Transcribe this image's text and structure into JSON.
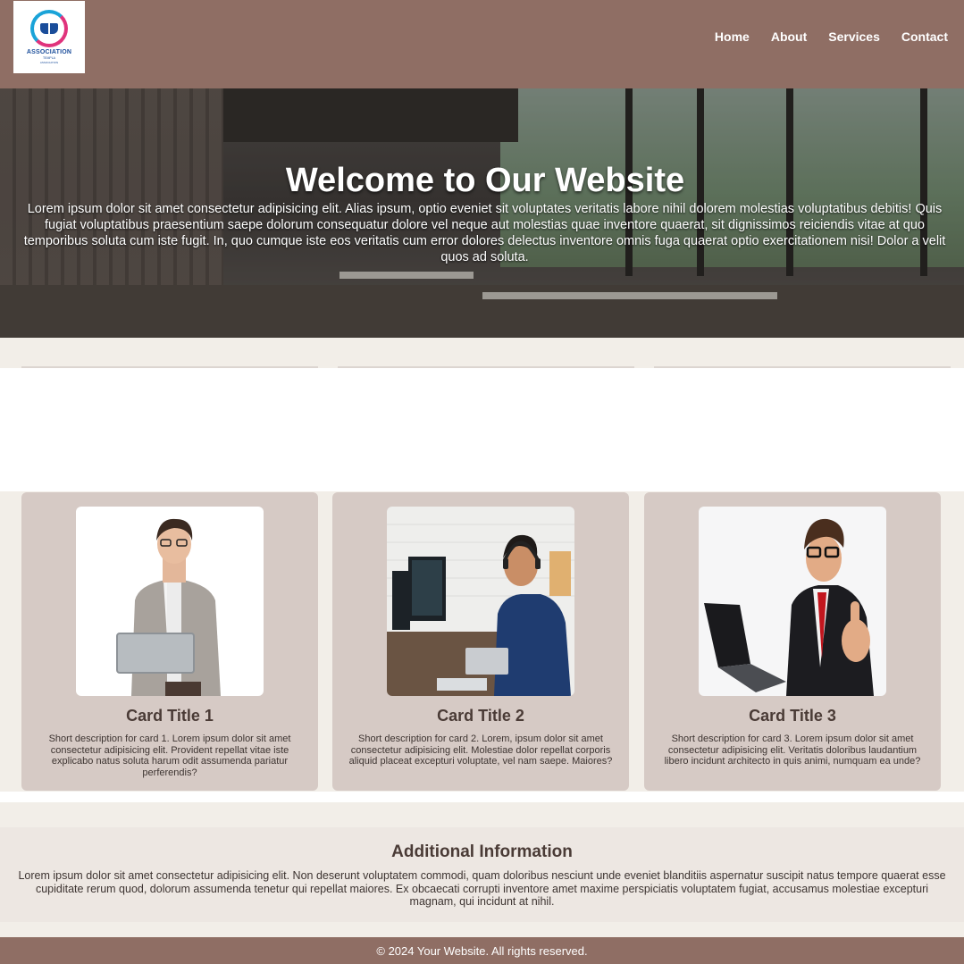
{
  "header": {
    "logo_text": "ASSOCIATION",
    "logo_sub": "TEMPLA",
    "logo_sub2": "ASSOCIATION",
    "nav": [
      "Home",
      "About",
      "Services",
      "Contact"
    ]
  },
  "hero": {
    "title": "Welcome to Our Website",
    "text": "Lorem ipsum dolor sit amet consectetur adipisicing elit. Alias ipsum, optio eveniet sit voluptates veritatis labore nihil dolorem molestias voluptatibus debitis! Quis fugiat voluptatibus praesentium saepe dolorum consequatur dolore vel neque aut molestias quae inventore quaerat, sit dignissimos reiciendis vitae at quo temporibus soluta cum iste fugit. In, quo cumque iste eos veritatis cum error dolores delectus inventore omnis fuga quaerat optio exercitationem nisi! Dolor a velit quos ad soluta."
  },
  "cards": [
    {
      "title": "Card Title 1",
      "description": "Short description for card 1. Lorem ipsum dolor sit amet consectetur adipisicing elit. Provident repellat vitae iste explicabo natus soluta harum odit assumenda pariatur perferendis?"
    },
    {
      "title": "Card Title 2",
      "description": "Short description for card 2. Lorem, ipsum dolor sit amet consectetur adipisicing elit. Molestiae dolor repellat corporis aliquid placeat excepturi voluptate, vel nam saepe. Maiores?"
    },
    {
      "title": "Card Title 3",
      "description": "Short description for card 3. Lorem ipsum dolor sit amet consectetur adipisicing elit. Veritatis doloribus laudantium libero incidunt architecto in quis animi, numquam ea unde?"
    }
  ],
  "info": {
    "title": "Additional Information",
    "text": "Lorem ipsum dolor sit amet consectetur adipisicing elit. Non deserunt voluptatem commodi, quam doloribus nesciunt unde eveniet blanditiis aspernatur suscipit natus tempore quaerat esse cupiditate rerum quod, dolorum assumenda tenetur qui repellat maiores. Ex obcaecati corrupti inventore amet maxime perspiciatis voluptatem fugiat, accusamus molestiae excepturi magnam, qui incidunt at nihil."
  },
  "footer": {
    "text": "© 2024 Your Website. All rights reserved."
  },
  "colors": {
    "header_bg": "#8f6e64",
    "card_bg": "#d6cac5",
    "page_bg": "#f2eee8"
  }
}
